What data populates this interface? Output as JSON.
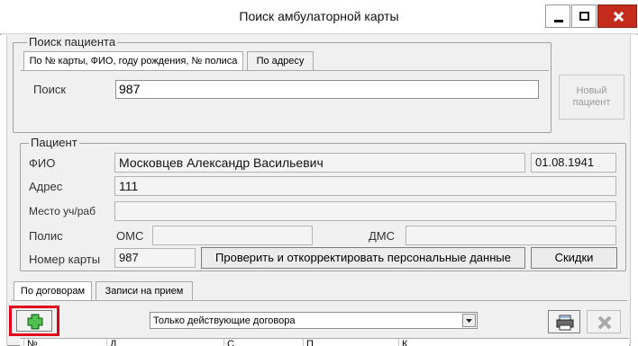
{
  "window": {
    "title": "Поиск амбулаторной карты"
  },
  "patient_search": {
    "legend": "Поиск пациента",
    "tabs": [
      {
        "label": "По № карты, ФИО, году рождения, № полиса",
        "active": true
      },
      {
        "label": "По адресу",
        "active": false
      }
    ],
    "search_label": "Поиск",
    "search_value": "987",
    "new_patient_label": "Новый пациент"
  },
  "patient": {
    "legend": "Пациент",
    "fio_label": "ФИО",
    "fio_value": "Московцев Александр Васильевич",
    "birth_date": "01.08.1941",
    "address_label": "Адрес",
    "address_value": "111",
    "work_label": "Место уч/раб",
    "work_value": "",
    "policy_label": "Полис",
    "oms_label": "ОМС",
    "oms_value": "",
    "dms_label": "ДМС",
    "dms_value": "",
    "card_label": "Номер карты",
    "card_value": "987",
    "verify_button": "Проверить и откорректировать персональные данные",
    "discounts_button": "Скидки"
  },
  "contracts": {
    "tabs": [
      {
        "label": "По договорам",
        "active": true
      },
      {
        "label": "Записи на прием",
        "active": false
      }
    ],
    "filter_value": "Только действующие договора",
    "add_icon": "plus-icon",
    "highlight_color": "#e0001b",
    "columns": [
      "№",
      "Д",
      "С",
      "П",
      "К"
    ]
  }
}
